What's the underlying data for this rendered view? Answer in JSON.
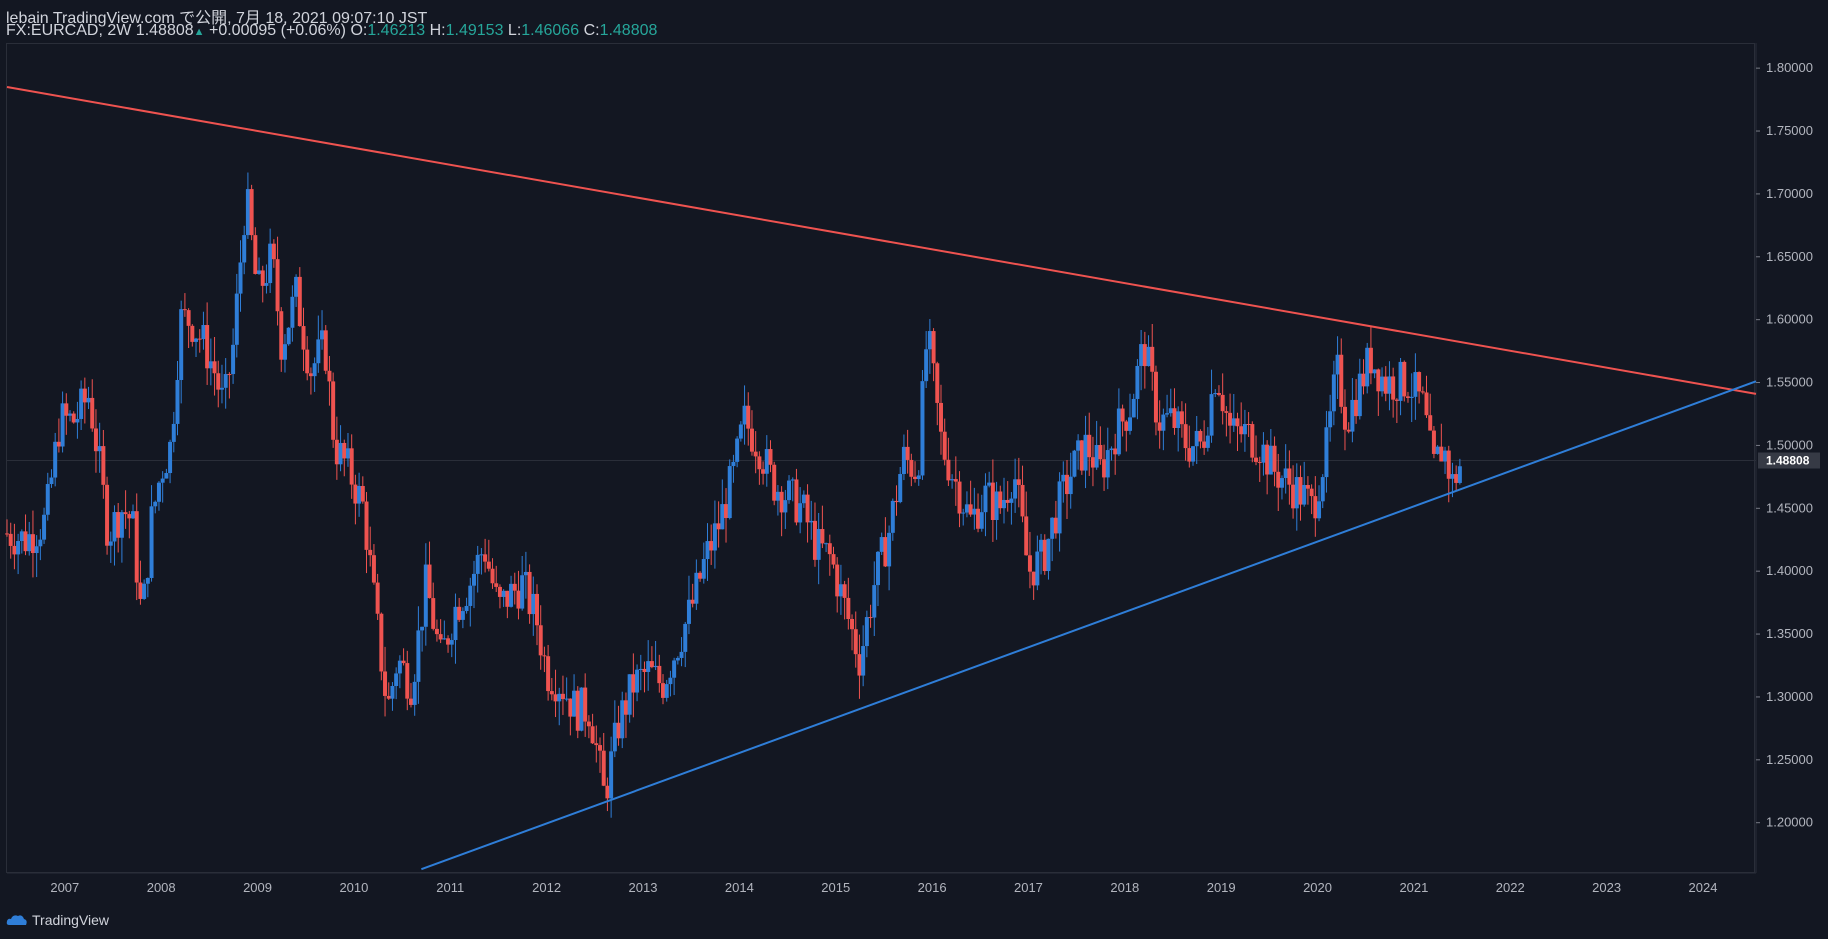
{
  "header": {
    "line1": "lebain TradingView.com で公開, 7月 18, 2021 09:07:10 JST",
    "symbol": "FX:EURCAD, 2W",
    "last": "1.48808",
    "change": "+0.00095 (+0.06%)",
    "o_label": "O:",
    "o_value": "1.46213",
    "h_label": "H:",
    "h_value": "1.49153",
    "l_label": "L:",
    "l_value": "1.46066",
    "c_label": "C:",
    "c_value": "1.48808"
  },
  "footer": {
    "brand": "TradingView"
  },
  "colors": {
    "background": "#131722",
    "up": "#2f7ed8",
    "down": "#ef5350",
    "resistance": "#ef5350",
    "support": "#2f7ed8",
    "grid": "#1e2230"
  },
  "chart_data": {
    "type": "candlestick",
    "symbol": "FX:EURCAD",
    "interval": "2W",
    "ylim": [
      1.16,
      1.82
    ],
    "y_ticks": [
      "1.80000",
      "1.75000",
      "1.70000",
      "1.65000",
      "1.60000",
      "1.55000",
      "1.50000",
      "1.45000",
      "1.40000",
      "1.35000",
      "1.30000",
      "1.25000",
      "1.20000"
    ],
    "xlim": [
      2006.4,
      2024.55
    ],
    "x_ticks": [
      "2007",
      "2008",
      "2009",
      "2010",
      "2011",
      "2012",
      "2013",
      "2014",
      "2015",
      "2016",
      "2017",
      "2018",
      "2019",
      "2020",
      "2021",
      "2022",
      "2023",
      "2024"
    ],
    "last_price": "1.48808",
    "close_series": [
      [
        2006.4,
        1.43
      ],
      [
        2006.6,
        1.425
      ],
      [
        2006.8,
        1.44
      ],
      [
        2006.95,
        1.52
      ],
      [
        2007.1,
        1.52
      ],
      [
        2007.25,
        1.54
      ],
      [
        2007.35,
        1.49
      ],
      [
        2007.45,
        1.43
      ],
      [
        2007.6,
        1.45
      ],
      [
        2007.7,
        1.44
      ],
      [
        2007.8,
        1.36
      ],
      [
        2007.9,
        1.44
      ],
      [
        2008.0,
        1.48
      ],
      [
        2008.1,
        1.5
      ],
      [
        2008.2,
        1.6
      ],
      [
        2008.3,
        1.6
      ],
      [
        2008.45,
        1.58
      ],
      [
        2008.55,
        1.56
      ],
      [
        2008.65,
        1.53
      ],
      [
        2008.75,
        1.58
      ],
      [
        2008.88,
        1.7
      ],
      [
        2009.0,
        1.62
      ],
      [
        2009.15,
        1.65
      ],
      [
        2009.25,
        1.58
      ],
      [
        2009.4,
        1.62
      ],
      [
        2009.55,
        1.56
      ],
      [
        2009.7,
        1.58
      ],
      [
        2009.8,
        1.5
      ],
      [
        2009.95,
        1.48
      ],
      [
        2010.1,
        1.45
      ],
      [
        2010.25,
        1.35
      ],
      [
        2010.35,
        1.29
      ],
      [
        2010.45,
        1.33
      ],
      [
        2010.6,
        1.31
      ],
      [
        2010.75,
        1.39
      ],
      [
        2010.9,
        1.33
      ],
      [
        2011.05,
        1.37
      ],
      [
        2011.2,
        1.39
      ],
      [
        2011.35,
        1.42
      ],
      [
        2011.5,
        1.37
      ],
      [
        2011.6,
        1.38
      ],
      [
        2011.75,
        1.39
      ],
      [
        2011.9,
        1.36
      ],
      [
        2012.0,
        1.32
      ],
      [
        2012.15,
        1.31
      ],
      [
        2012.3,
        1.29
      ],
      [
        2012.45,
        1.29
      ],
      [
        2012.6,
        1.22
      ],
      [
        2012.75,
        1.28
      ],
      [
        2012.9,
        1.31
      ],
      [
        2013.05,
        1.32
      ],
      [
        2013.2,
        1.31
      ],
      [
        2013.35,
        1.34
      ],
      [
        2013.5,
        1.37
      ],
      [
        2013.65,
        1.41
      ],
      [
        2013.8,
        1.44
      ],
      [
        2013.95,
        1.48
      ],
      [
        2014.05,
        1.52
      ],
      [
        2014.2,
        1.5
      ],
      [
        2014.35,
        1.47
      ],
      [
        2014.5,
        1.46
      ],
      [
        2014.65,
        1.45
      ],
      [
        2014.8,
        1.42
      ],
      [
        2014.95,
        1.41
      ],
      [
        2015.1,
        1.37
      ],
      [
        2015.25,
        1.33
      ],
      [
        2015.4,
        1.39
      ],
      [
        2015.55,
        1.43
      ],
      [
        2015.7,
        1.49
      ],
      [
        2015.85,
        1.48
      ],
      [
        2015.95,
        1.59
      ],
      [
        2016.1,
        1.5
      ],
      [
        2016.25,
        1.47
      ],
      [
        2016.4,
        1.44
      ],
      [
        2016.55,
        1.46
      ],
      [
        2016.7,
        1.45
      ],
      [
        2016.85,
        1.48
      ],
      [
        2017.0,
        1.4
      ],
      [
        2017.15,
        1.41
      ],
      [
        2017.3,
        1.45
      ],
      [
        2017.45,
        1.48
      ],
      [
        2017.6,
        1.5
      ],
      [
        2017.75,
        1.48
      ],
      [
        2017.9,
        1.51
      ],
      [
        2018.05,
        1.53
      ],
      [
        2018.2,
        1.58
      ],
      [
        2018.35,
        1.52
      ],
      [
        2018.5,
        1.52
      ],
      [
        2018.65,
        1.5
      ],
      [
        2018.8,
        1.5
      ],
      [
        2018.95,
        1.56
      ],
      [
        2019.1,
        1.51
      ],
      [
        2019.25,
        1.51
      ],
      [
        2019.4,
        1.5
      ],
      [
        2019.55,
        1.48
      ],
      [
        2019.7,
        1.47
      ],
      [
        2019.85,
        1.46
      ],
      [
        2019.95,
        1.45
      ],
      [
        2020.1,
        1.5
      ],
      [
        2020.2,
        1.56
      ],
      [
        2020.3,
        1.52
      ],
      [
        2020.45,
        1.55
      ],
      [
        2020.55,
        1.57
      ],
      [
        2020.7,
        1.55
      ],
      [
        2020.85,
        1.55
      ],
      [
        2020.95,
        1.55
      ],
      [
        2021.1,
        1.53
      ],
      [
        2021.2,
        1.48
      ],
      [
        2021.3,
        1.5
      ],
      [
        2021.4,
        1.47
      ],
      [
        2021.5,
        1.488
      ]
    ],
    "trendlines": [
      {
        "name": "resistance",
        "color": "#ef5350",
        "p1": [
          2006.4,
          1.785
        ],
        "p2": [
          2024.55,
          1.541
        ]
      },
      {
        "name": "support",
        "color": "#2f7ed8",
        "p1": [
          2010.7,
          1.163
        ],
        "p2": [
          2024.55,
          1.551
        ]
      }
    ]
  }
}
